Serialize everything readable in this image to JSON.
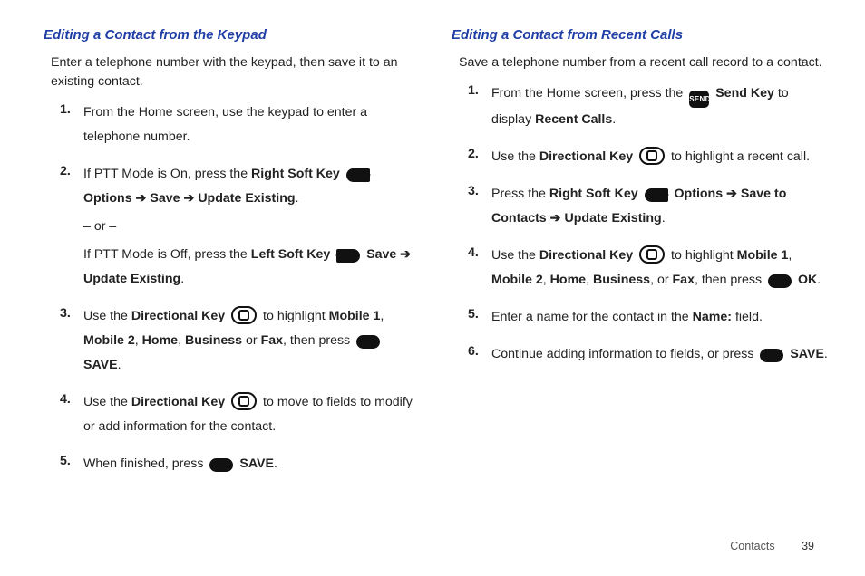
{
  "left": {
    "heading": "Editing a Contact from the Keypad",
    "intro": "Enter a telephone number with the keypad, then save it to an existing contact.",
    "s1": "From the Home screen, use the keypad to enter a telephone number.",
    "s2_a": "If PTT Mode is On, press the ",
    "s2_rsk": "Right Soft Key",
    "s2_opt": " Options ",
    "s2_save": " Save ",
    "s2_upd": " Update Existing",
    "s2_or": "– or –",
    "s2_b": "If PTT Mode is Off, press the ",
    "s2_lsk": "Left Soft Key",
    "s2_save2": " Save ",
    "s2_upd2": "Update Existing",
    "s3_a": "Use the ",
    "s3_dk": "Directional Key",
    "s3_b": " to highlight ",
    "s3_m1": "Mobile 1",
    "s3_m2": "Mobile 2",
    "s3_home": "Home",
    "s3_bus": "Business",
    "s3_or": " or ",
    "s3_fax": "Fax",
    "s3_then": ", then press ",
    "s3_save": " SAVE",
    "s4_a": "Use the ",
    "s4_dk": "Directional Key",
    "s4_b": " to move to fields to modify or add information for the contact.",
    "s5_a": "When finished, press ",
    "s5_save": " SAVE"
  },
  "right": {
    "heading": "Editing a Contact from Recent Calls",
    "intro": "Save a telephone number from a recent call record to a contact.",
    "s1_a": "From the Home screen, press the ",
    "s1_send": "SEND",
    "s1_sk": " Send Key",
    "s1_b": " to display ",
    "s1_rc": "Recent Calls",
    "s2_a": "Use the ",
    "s2_dk": "Directional Key",
    "s2_b": " to highlight a recent call.",
    "s3_a": "Press the ",
    "s3_rsk": "Right Soft Key",
    "s3_opt": " Options ",
    "s3_stc": " Save to Contacts ",
    "s3_upd": " Update Existing",
    "s4_a": "Use the ",
    "s4_dk": "Directional Key",
    "s4_b": " to highlight ",
    "s4_m1": "Mobile 1",
    "s4_m2": "Mobile 2",
    "s4_home": "Home",
    "s4_bus": "Business",
    "s4_or": ", or ",
    "s4_fax": "Fax",
    "s4_then": ", then press ",
    "s4_ok": " OK",
    "s5_a": "Enter a name for the contact in the ",
    "s5_name": "Name:",
    "s5_b": " field.",
    "s6_a": "Continue adding information to fields, or press ",
    "s6_save": " SAVE"
  },
  "arrow": "➔",
  "period": ".",
  "comma": ", ",
  "footer": {
    "section": "Contacts",
    "page": "39"
  }
}
